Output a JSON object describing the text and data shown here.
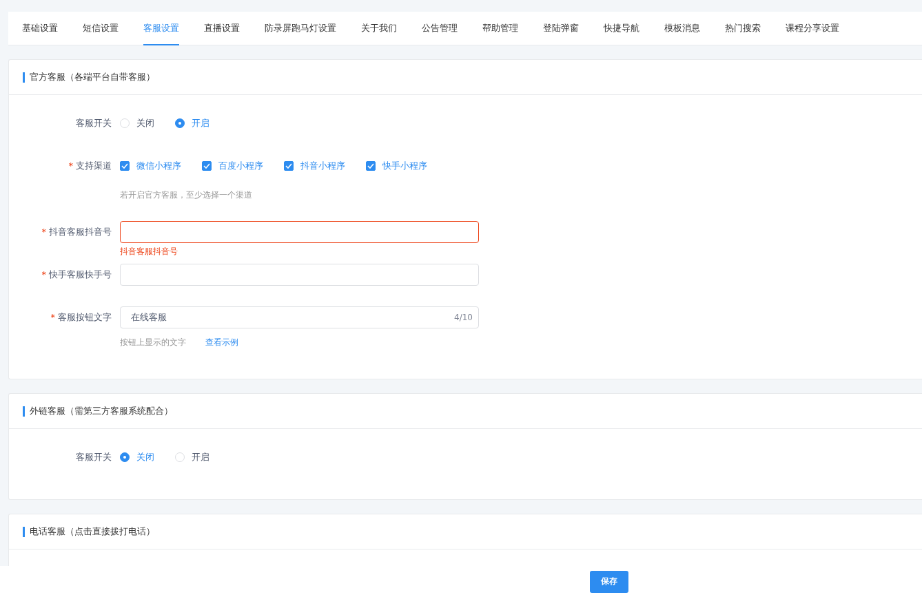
{
  "tabs": [
    {
      "label": "基础设置",
      "selected": false
    },
    {
      "label": "短信设置",
      "selected": false
    },
    {
      "label": "客服设置",
      "selected": true
    },
    {
      "label": "直播设置",
      "selected": false
    },
    {
      "label": "防录屏跑马灯设置",
      "selected": false
    },
    {
      "label": "关于我们",
      "selected": false
    },
    {
      "label": "公告管理",
      "selected": false
    },
    {
      "label": "帮助管理",
      "selected": false
    },
    {
      "label": "登陆弹窗",
      "selected": false
    },
    {
      "label": "快捷导航",
      "selected": false
    },
    {
      "label": "模板消息",
      "selected": false
    },
    {
      "label": "热门搜索",
      "selected": false
    },
    {
      "label": "课程分享设置",
      "selected": false
    }
  ],
  "sections": [
    {
      "title": "官方客服（各端平台自带客服）",
      "fields": [
        {
          "kind": "radio",
          "label": "客服开关",
          "options": [
            {
              "label": "关闭",
              "selected": false
            },
            {
              "label": "开启",
              "selected": true
            }
          ]
        },
        {
          "kind": "checkboxes",
          "label": "支持渠道",
          "required_mark": "*",
          "options": [
            {
              "label": "微信小程序",
              "checked": true
            },
            {
              "label": "百度小程序",
              "checked": true
            },
            {
              "label": "抖音小程序",
              "checked": true
            },
            {
              "label": "快手小程序",
              "checked": true
            }
          ],
          "help": "若开启官方客服，至少选择一个渠道"
        },
        {
          "kind": "text",
          "label": "抖音客服抖音号",
          "required_mark": "*",
          "error": "抖音客服抖音号"
        },
        {
          "kind": "text",
          "label": "快手客服快手号",
          "required_mark": "*"
        },
        {
          "kind": "text",
          "label": "客服按钮文字",
          "required_mark": "*",
          "value": "在线客服",
          "counter": "4/10",
          "help": "按钮上显示的文字",
          "link": "查看示例"
        }
      ]
    },
    {
      "title": "外链客服（需第三方客服系统配合）",
      "fields": [
        {
          "kind": "radio",
          "label": "客服开关",
          "options": [
            {
              "label": "关闭",
              "selected": true
            },
            {
              "label": "开启",
              "selected": false
            }
          ]
        }
      ]
    },
    {
      "title": "电话客服（点击直接拨打电话）"
    }
  ],
  "footer": {
    "save": "保存"
  }
}
